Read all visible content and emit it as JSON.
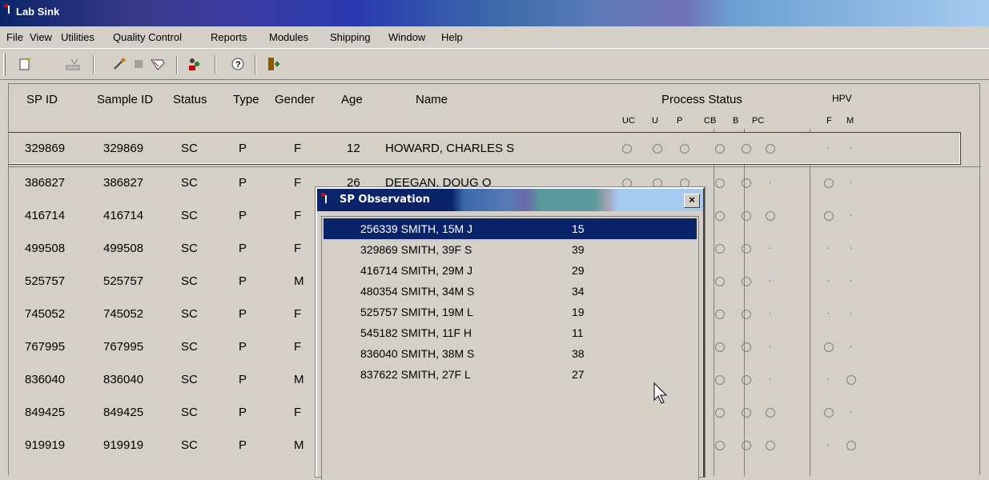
{
  "window": {
    "title": "Lab Sink"
  },
  "menu": [
    "File",
    "View",
    "Utilities",
    "Quality Control",
    "Reports",
    "Modules",
    "Shipping",
    "Window",
    "Help"
  ],
  "toolbar": {
    "icons": [
      "new-icon",
      "import-icon",
      "pen-icon",
      "stop-icon",
      "tag-icon",
      "users-icon",
      "help-icon",
      "exit-icon"
    ]
  },
  "table": {
    "headers": {
      "spid": "SP ID",
      "sample": "Sample ID",
      "status": "Status",
      "type": "Type",
      "gender": "Gender",
      "age": "Age",
      "name": "Name",
      "process": "Process Status",
      "hpv": "HPV"
    },
    "subheaders": [
      "UC",
      "U",
      "P",
      "CB",
      "B",
      "PC",
      "F",
      "M"
    ],
    "rows": [
      {
        "spid": "329869",
        "sample": "329869",
        "status": "SC",
        "type": "P",
        "gender": "F",
        "age": "12",
        "name": "HOWARD, CHARLES S",
        "proc": [
          "o",
          "o",
          "o",
          "o",
          "o",
          "o"
        ],
        "hpv": [
          ".",
          "."
        ]
      },
      {
        "spid": "386827",
        "sample": "386827",
        "status": "SC",
        "type": "P",
        "gender": "F",
        "age": "26",
        "name": "DEEGAN, DOUG O",
        "proc": [
          "o",
          "o",
          "o",
          "o",
          "o",
          "."
        ],
        "hpv": [
          "o",
          "."
        ]
      },
      {
        "spid": "416714",
        "sample": "416714",
        "status": "SC",
        "type": "P",
        "gender": "F",
        "age": "",
        "name": "",
        "proc": [
          "",
          "",
          "",
          "o",
          "o",
          "o"
        ],
        "hpv": [
          "o",
          "."
        ]
      },
      {
        "spid": "499508",
        "sample": "499508",
        "status": "SC",
        "type": "P",
        "gender": "F",
        "age": "",
        "name": "",
        "proc": [
          "",
          "",
          "",
          "o",
          "o",
          "."
        ],
        "hpv": [
          ".",
          "."
        ]
      },
      {
        "spid": "525757",
        "sample": "525757",
        "status": "SC",
        "type": "P",
        "gender": "M",
        "age": "",
        "name": "",
        "proc": [
          "",
          "",
          "",
          "o",
          "o",
          "."
        ],
        "hpv": [
          ".",
          "."
        ]
      },
      {
        "spid": "745052",
        "sample": "745052",
        "status": "SC",
        "type": "P",
        "gender": "F",
        "age": "",
        "name": "",
        "proc": [
          "",
          "",
          "",
          "o",
          "o",
          "."
        ],
        "hpv": [
          ".",
          "."
        ]
      },
      {
        "spid": "767995",
        "sample": "767995",
        "status": "SC",
        "type": "P",
        "gender": "F",
        "age": "",
        "name": "",
        "proc": [
          "",
          "",
          "",
          "o",
          "o",
          "."
        ],
        "hpv": [
          "o",
          "."
        ]
      },
      {
        "spid": "836040",
        "sample": "836040",
        "status": "SC",
        "type": "P",
        "gender": "M",
        "age": "",
        "name": "",
        "proc": [
          "",
          "",
          "",
          "o",
          "o",
          "."
        ],
        "hpv": [
          ".",
          "o"
        ]
      },
      {
        "spid": "849425",
        "sample": "849425",
        "status": "SC",
        "type": "P",
        "gender": "F",
        "age": "",
        "name": "",
        "proc": [
          "",
          "",
          "",
          "o",
          "o",
          "o"
        ],
        "hpv": [
          "o",
          "."
        ]
      },
      {
        "spid": "919919",
        "sample": "919919",
        "status": "SC",
        "type": "P",
        "gender": "M",
        "age": "",
        "name": "",
        "proc": [
          "",
          "",
          "",
          "o",
          "o",
          "o"
        ],
        "hpv": [
          ".",
          "o"
        ]
      }
    ]
  },
  "dialog": {
    "title": "SP Observation",
    "close": "×",
    "items": [
      {
        "name": "256339 SMITH, 15M J",
        "age": "15"
      },
      {
        "name": "329869 SMITH, 39F S",
        "age": "39"
      },
      {
        "name": "416714 SMITH, 29M J",
        "age": "29"
      },
      {
        "name": "480354 SMITH, 34M S",
        "age": "34"
      },
      {
        "name": "525757 SMITH, 19M L",
        "age": "19"
      },
      {
        "name": "545182 SMITH, 11F H",
        "age": "11"
      },
      {
        "name": "836040 SMITH, 38M S",
        "age": "38"
      },
      {
        "name": "837622 SMITH, 27F L",
        "age": "27"
      }
    ]
  }
}
